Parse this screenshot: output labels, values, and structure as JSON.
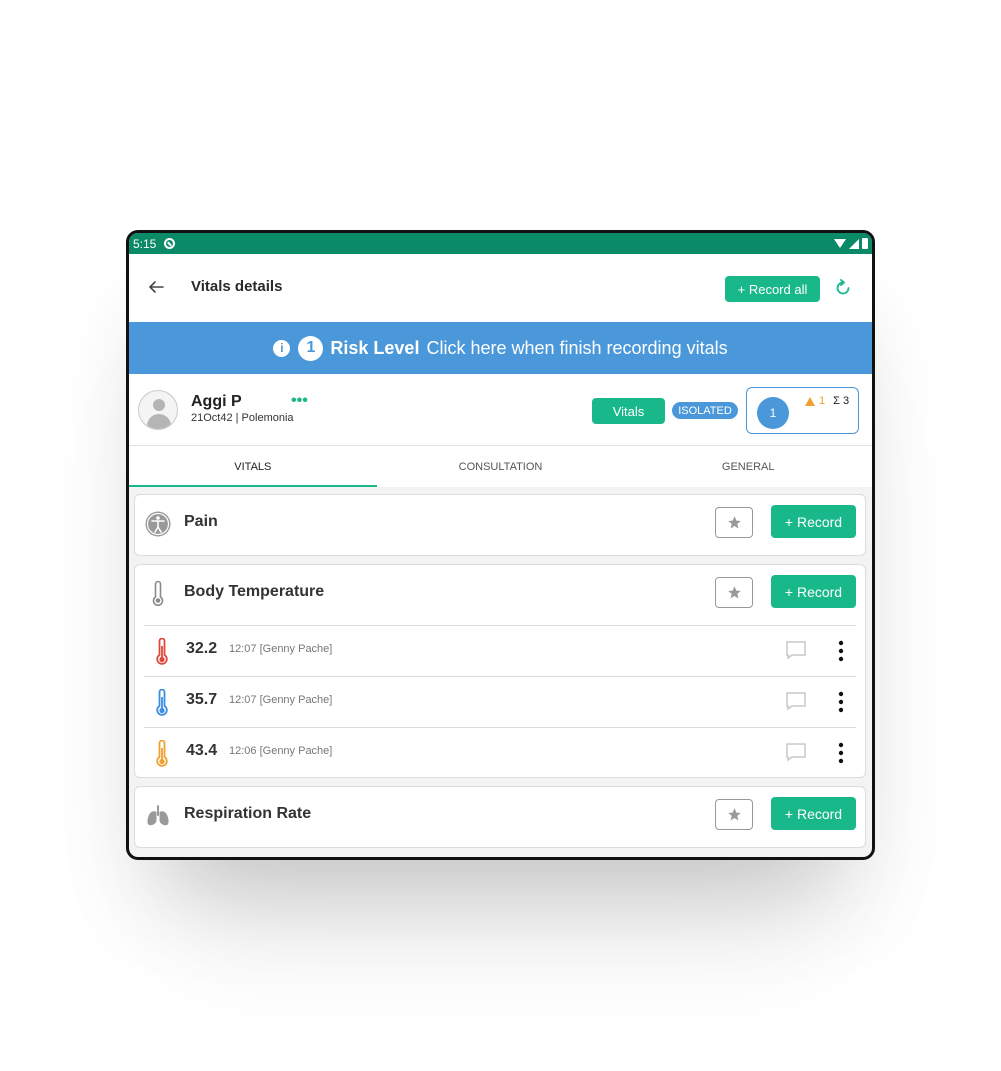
{
  "status_bar": {
    "time": "5:15"
  },
  "app_bar": {
    "title": "Vitals details",
    "record_all_label": "+ Record all"
  },
  "banner": {
    "risk_number": "1",
    "risk_label": "Risk Level",
    "message": "Click here when finish recording vitals"
  },
  "patient": {
    "name": "Aggi P",
    "meta": "21Oct42 | Polemonia",
    "more": "•••",
    "vitals_label": "Vitals",
    "isolated_label": "ISOLATED",
    "score": "1",
    "warning_count": "1",
    "sigma": "Σ 3"
  },
  "tabs": [
    {
      "label": "VITALS",
      "active": true
    },
    {
      "label": "CONSULTATION",
      "active": false
    },
    {
      "label": "GENERAL",
      "active": false
    }
  ],
  "sections": {
    "pain": {
      "title": "Pain",
      "record_label": "+ Record",
      "icon": "accessibility-icon"
    },
    "body_temperature": {
      "title": "Body Temperature",
      "record_label": "+ Record",
      "icon": "thermometer-icon",
      "readings": [
        {
          "value": "32.2",
          "meta": "12:07 [Genny Pache]",
          "color": "#e0483c"
        },
        {
          "value": "35.7",
          "meta": "12:07 [Genny Pache]",
          "color": "#3a8ee0"
        },
        {
          "value": "43.4",
          "meta": "12:06 [Genny Pache]",
          "color": "#f0a030"
        }
      ]
    },
    "respiration_rate": {
      "title": "Respiration Rate",
      "record_label": "+ Record",
      "icon": "lungs-icon"
    }
  },
  "colors": {
    "primary_green": "#19b88a",
    "status_green": "#0a8a66",
    "banner_blue": "#4a98d9"
  }
}
